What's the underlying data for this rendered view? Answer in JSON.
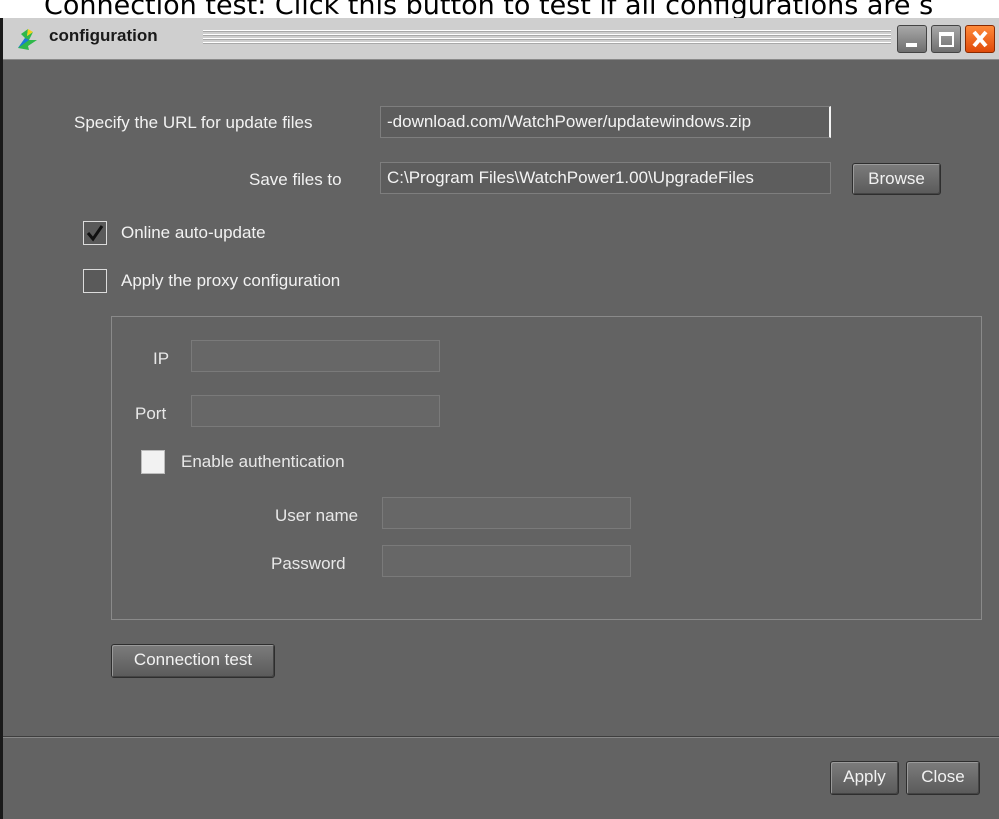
{
  "caption": "Connection test: Click this button to test if all configurations are s",
  "window": {
    "title": "configuration",
    "icon": "app-logo-icon",
    "controls": [
      "minimize-icon",
      "maximize-icon",
      "close-icon"
    ]
  },
  "form": {
    "url_label": "Specify the URL for update files",
    "url_value": "-download.com/WatchPower/updatewindows.zip",
    "save_label": "Save files to",
    "save_value": "C:\\Program Files\\WatchPower1.00\\UpgradeFiles",
    "browse_label": "Browse",
    "online_update_label": "Online auto-update",
    "online_update_checked": true,
    "proxy_label": "Apply the proxy configuration",
    "proxy_checked": false
  },
  "proxy": {
    "ip_label": "IP",
    "ip_value": "",
    "port_label": "Port",
    "port_value": "",
    "auth_label": "Enable authentication",
    "auth_checked": false,
    "username_label": "User name",
    "username_value": "",
    "password_label": "Password",
    "password_value": ""
  },
  "buttons": {
    "connection_test": "Connection test",
    "apply": "Apply",
    "close": "Close"
  },
  "colors": {
    "window_bg": "#636363",
    "titlebar_bg": "#cfcfcf",
    "close_button": "#e8581a"
  }
}
